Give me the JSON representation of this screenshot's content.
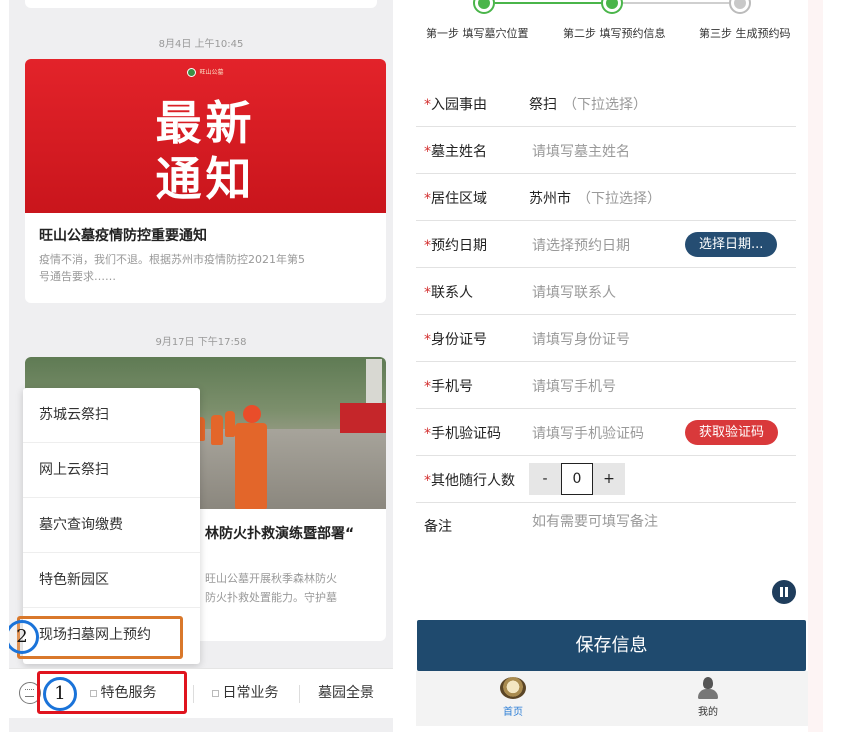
{
  "left": {
    "feed": [
      {
        "timestamp": "8月4日 上午10:45",
        "banner_logo": "旺山公墓",
        "banner_line1": "最新",
        "banner_line2": "通知",
        "title": "旺山公墓疫情防控重要通知",
        "desc_line1": "疫情不消，我们不退。根据苏州市疫情防控2021年第5",
        "desc_line2": "号通告要求……"
      },
      {
        "timestamp": "9月17日 下午17:58",
        "title_visible": "林防火扑救演练暨部署“",
        "desc_line1": "旺山公墓开展秋季森林防火",
        "desc_line2": "防火扑救处置能力。守护墓"
      }
    ],
    "popup_menu": [
      "苏城云祭扫",
      "网上云祭扫",
      "墓穴查询缴费",
      "特色新园区",
      "现场扫墓网上预约"
    ],
    "tabs": [
      "特色服务",
      "日常业务",
      "墓园全景"
    ],
    "annotations": {
      "circle1": "1",
      "circle2": "2"
    }
  },
  "right": {
    "steps": [
      "第一步 填写墓穴位置",
      "第二步 填写预约信息",
      "第三步 生成预约码"
    ],
    "fields": {
      "reason": {
        "label": "入园事由",
        "value": "祭扫",
        "hint": "（下拉选择）"
      },
      "owner": {
        "label": "墓主姓名",
        "placeholder": "请填写墓主姓名"
      },
      "region": {
        "label": "居住区域",
        "value": "苏州市",
        "hint": "（下拉选择）"
      },
      "date": {
        "label": "预约日期",
        "placeholder": "请选择预约日期",
        "button": "选择日期..."
      },
      "contact": {
        "label": "联系人",
        "placeholder": "请填写联系人"
      },
      "idcard": {
        "label": "身份证号",
        "placeholder": "请填写身份证号"
      },
      "phone": {
        "label": "手机号",
        "placeholder": "请填写手机号"
      },
      "code": {
        "label": "手机验证码",
        "placeholder": "请填写手机验证码",
        "button": "获取验证码"
      },
      "companions": {
        "label": "其他随行人数",
        "minus": "-",
        "value": "0",
        "plus": "+"
      },
      "remark": {
        "label": "备注",
        "placeholder": "如有需要可填写备注"
      }
    },
    "required_mark": "*",
    "save_button": "保存信息",
    "nav": [
      {
        "label": "首页",
        "icon": "home-icon",
        "active": true
      },
      {
        "label": "我的",
        "icon": "user-icon",
        "active": false
      }
    ]
  },
  "colors": {
    "accent_navy": "#1f4a6e",
    "date_pill": "#254d72",
    "code_pill": "#d9393b",
    "step_green": "#4ab54a",
    "required_red": "#d32f2f",
    "highlight_red": "#e0141e",
    "highlight_orange": "#d9782b",
    "highlight_blue": "#1a73d9"
  }
}
